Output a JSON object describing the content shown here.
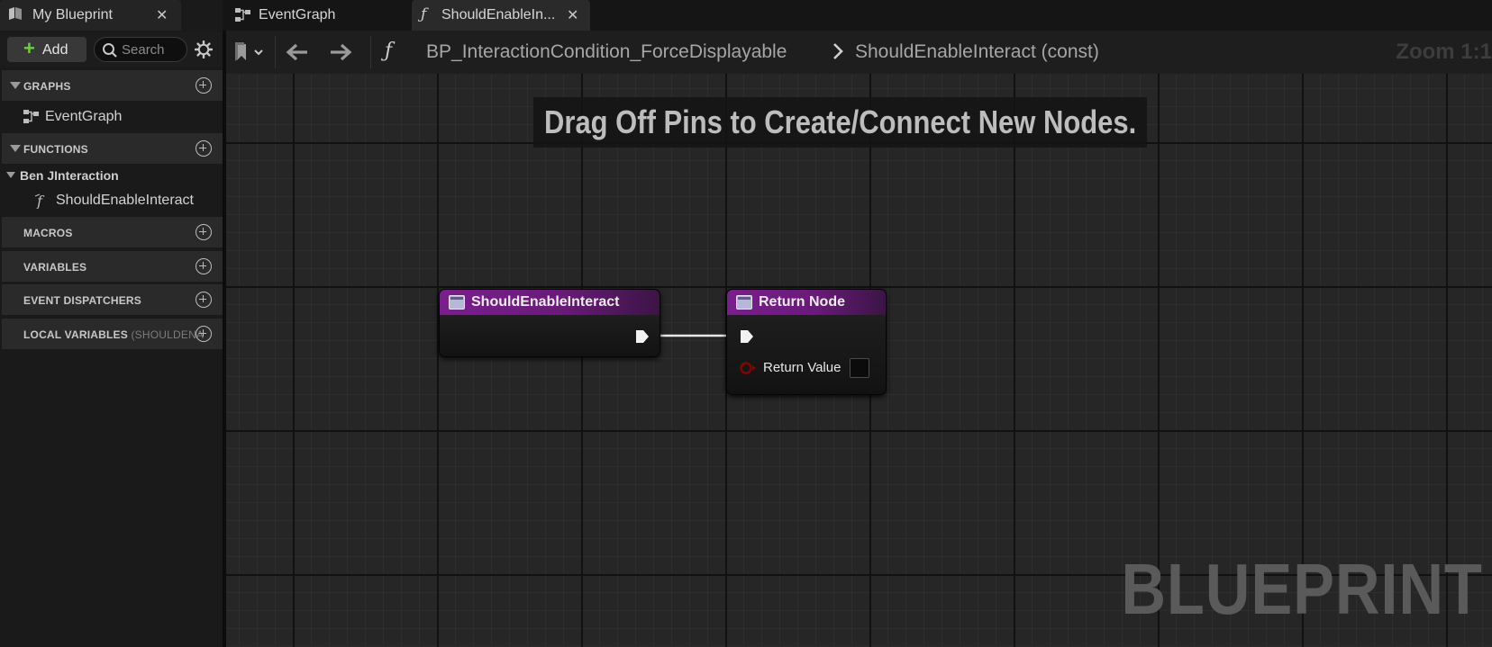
{
  "panel": {
    "title": "My Blueprint",
    "close_glyph": "✕",
    "add_label": "Add",
    "search_placeholder": "Search"
  },
  "sections": {
    "graphs": "GRAPHS",
    "functions": "FUNCTIONS",
    "macros": "MACROS",
    "variables": "VARIABLES",
    "event_dispatchers": "EVENT DISPATCHERS",
    "local_variables": "LOCAL VARIABLES",
    "local_variables_sub": "(SHOULDENA"
  },
  "tree": {
    "event_graph": "EventGraph",
    "category": "Ben JInteraction",
    "function": "ShouldEnableInteract"
  },
  "tabs": [
    {
      "label": "EventGraph"
    },
    {
      "label": "ShouldEnableIn..."
    }
  ],
  "toolbar": {
    "fn_glyph": "ƒ",
    "blueprint_name": "BP_InteractionCondition_ForceDisplayable",
    "function_name": "ShouldEnableInteract (const)",
    "zoom": "Zoom 1:1"
  },
  "graph": {
    "hint": "Drag Off Pins to Create/Connect New Nodes.",
    "watermark": "BLUEPRINT",
    "entry_node_title": "ShouldEnableInteract",
    "return_node_title": "Return Node",
    "return_value_label": "Return Value"
  },
  "colors": {
    "node_header": "#7a1e8e",
    "add_plus": "#6bd23a",
    "bool_pin": "#8b0000"
  },
  "icons": [
    "blueprint-icon",
    "close-icon",
    "plus-icon",
    "search-icon",
    "gear-icon",
    "graph-icon",
    "function-icon",
    "add-circle-icon",
    "bookmark-icon",
    "back-arrow-icon",
    "forward-arrow-icon",
    "chevron-right-icon",
    "exec-pin-icon",
    "bool-pin-icon"
  ]
}
